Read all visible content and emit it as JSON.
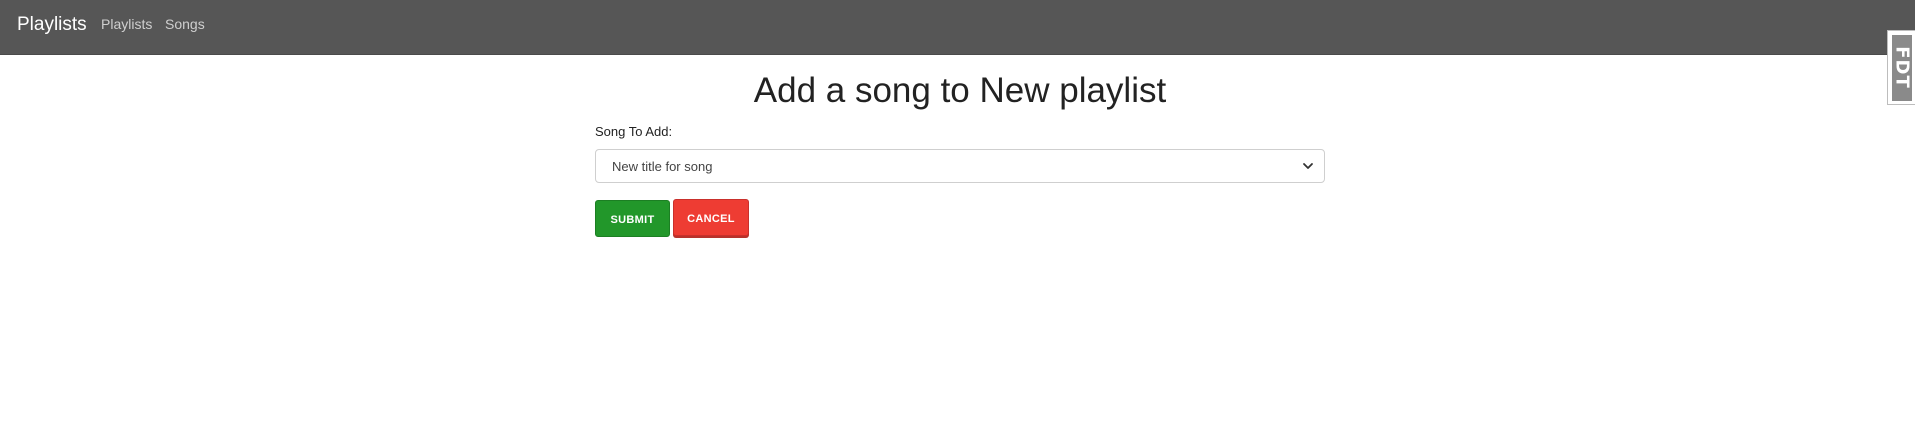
{
  "navbar": {
    "brand": "Playlists",
    "links": [
      {
        "label": "Playlists"
      },
      {
        "label": "Songs"
      }
    ]
  },
  "side_tab": {
    "label": "FDT"
  },
  "form": {
    "title": "Add a song to New playlist",
    "song_label": "Song To Add:",
    "song_select": {
      "selected": "New title for song"
    },
    "submit_label": "SUBMIT",
    "cancel_label": "CANCEL"
  },
  "colors": {
    "navbar_bg": "#565656",
    "submit_bg": "#22972a",
    "cancel_bg": "#ee3c33"
  },
  "icons": {
    "select_arrow": "chevron-down-icon"
  }
}
